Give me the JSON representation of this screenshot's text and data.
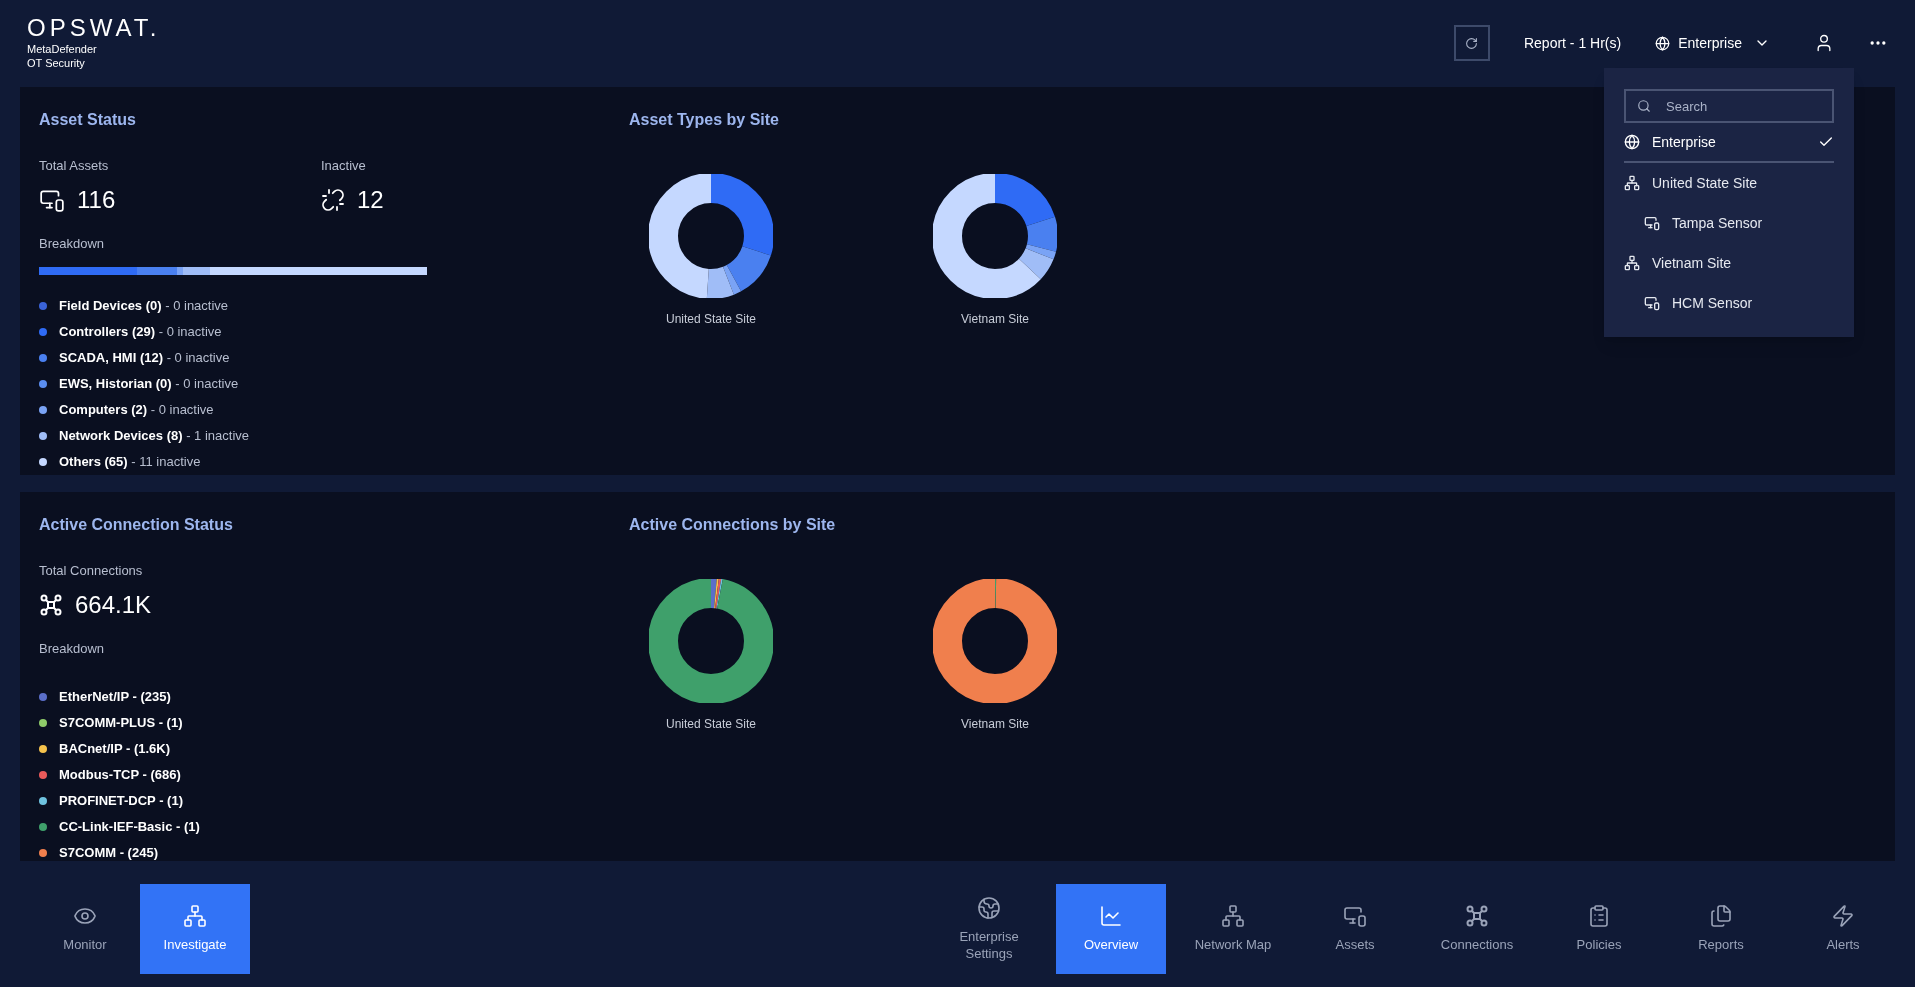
{
  "header": {
    "logo": "OPSWAT.",
    "product": [
      "MetaDefender",
      "OT Security"
    ]
  },
  "toolbar": {
    "report": "Report - 1 Hr(s)",
    "scope": "Enterprise"
  },
  "scope_menu": {
    "search": {
      "placeholder": "Search"
    },
    "items": [
      {
        "label": "Enterprise",
        "kind": "enterprise",
        "selected": true
      },
      {
        "label": "United State Site",
        "kind": "site",
        "selected": false,
        "children": [
          {
            "label": "Tampa Sensor",
            "kind": "sensor",
            "selected": false
          }
        ]
      },
      {
        "label": "Vietnam Site",
        "kind": "site",
        "selected": false,
        "children": [
          {
            "label": "HCM Sensor",
            "kind": "sensor",
            "selected": false
          }
        ]
      }
    ]
  },
  "asset_status": {
    "title": "Asset Status",
    "total_label": "Total Assets",
    "total_value": "116",
    "inactive_label": "Inactive",
    "inactive_value": "12",
    "breakdown_label": "Breakdown",
    "legend": [
      {
        "text": "**Field Devices (0)** - 0 inactive",
        "color": "#3a63d8"
      },
      {
        "text": "**Controllers (29)** - 0 inactive",
        "color": "#2f6bf5"
      },
      {
        "text": "**SCADA, HMI (12)** - 0 inactive",
        "color": "#4a80f0"
      },
      {
        "text": "**EWS, Historian (0)** - 0 inactive",
        "color": "#5b8ef0"
      },
      {
        "text": "**Computers (2)** - 0 inactive",
        "color": "#7aa3f5"
      },
      {
        "text": "**Network Devices (8)** - 1 inactive",
        "color": "#a0bdf7"
      },
      {
        "text": "**Others (65)** - 11 inactive",
        "color": "#c5d8ff"
      }
    ]
  },
  "asset_types": {
    "title": "Asset Types by Site",
    "sites": [
      "United State Site",
      "Vietnam Site"
    ]
  },
  "connection_status": {
    "title": "Active Connection Status",
    "total_label": "Total Connections",
    "total_value": "664.1K",
    "breakdown_label": "Breakdown",
    "legend": [
      {
        "text": "EtherNet/IP - (235)",
        "color": "#5b6fc9"
      },
      {
        "text": "S7COMM-PLUS - (1)",
        "color": "#8fcc6a"
      },
      {
        "text": "BACnet/IP - (1.6K)",
        "color": "#f5c24c"
      },
      {
        "text": "Modbus-TCP - (686)",
        "color": "#ea5a5a"
      },
      {
        "text": "PROFINET-DCP - (1)",
        "color": "#6fc3e0"
      },
      {
        "text": "CC-Link-IEF-Basic - (1)",
        "color": "#3fa06b"
      },
      {
        "text": "S7COMM - (245)",
        "color": "#f07f4d"
      }
    ]
  },
  "connections_by_site": {
    "title": "Active Connections by Site",
    "sites": [
      "United State Site",
      "Vietnam Site"
    ]
  },
  "nav_left": [
    {
      "label": "Monitor",
      "selected": false
    },
    {
      "label": "Investigate",
      "selected": true
    }
  ],
  "nav_right": [
    {
      "label": "Enterprise Settings",
      "selected": false
    },
    {
      "label": "Overview",
      "selected": true
    },
    {
      "label": "Network Map",
      "selected": false
    },
    {
      "label": "Assets",
      "selected": false
    },
    {
      "label": "Connections",
      "selected": false
    },
    {
      "label": "Policies",
      "selected": false
    },
    {
      "label": "Reports",
      "selected": false
    },
    {
      "label": "Alerts",
      "selected": false
    }
  ]
}
